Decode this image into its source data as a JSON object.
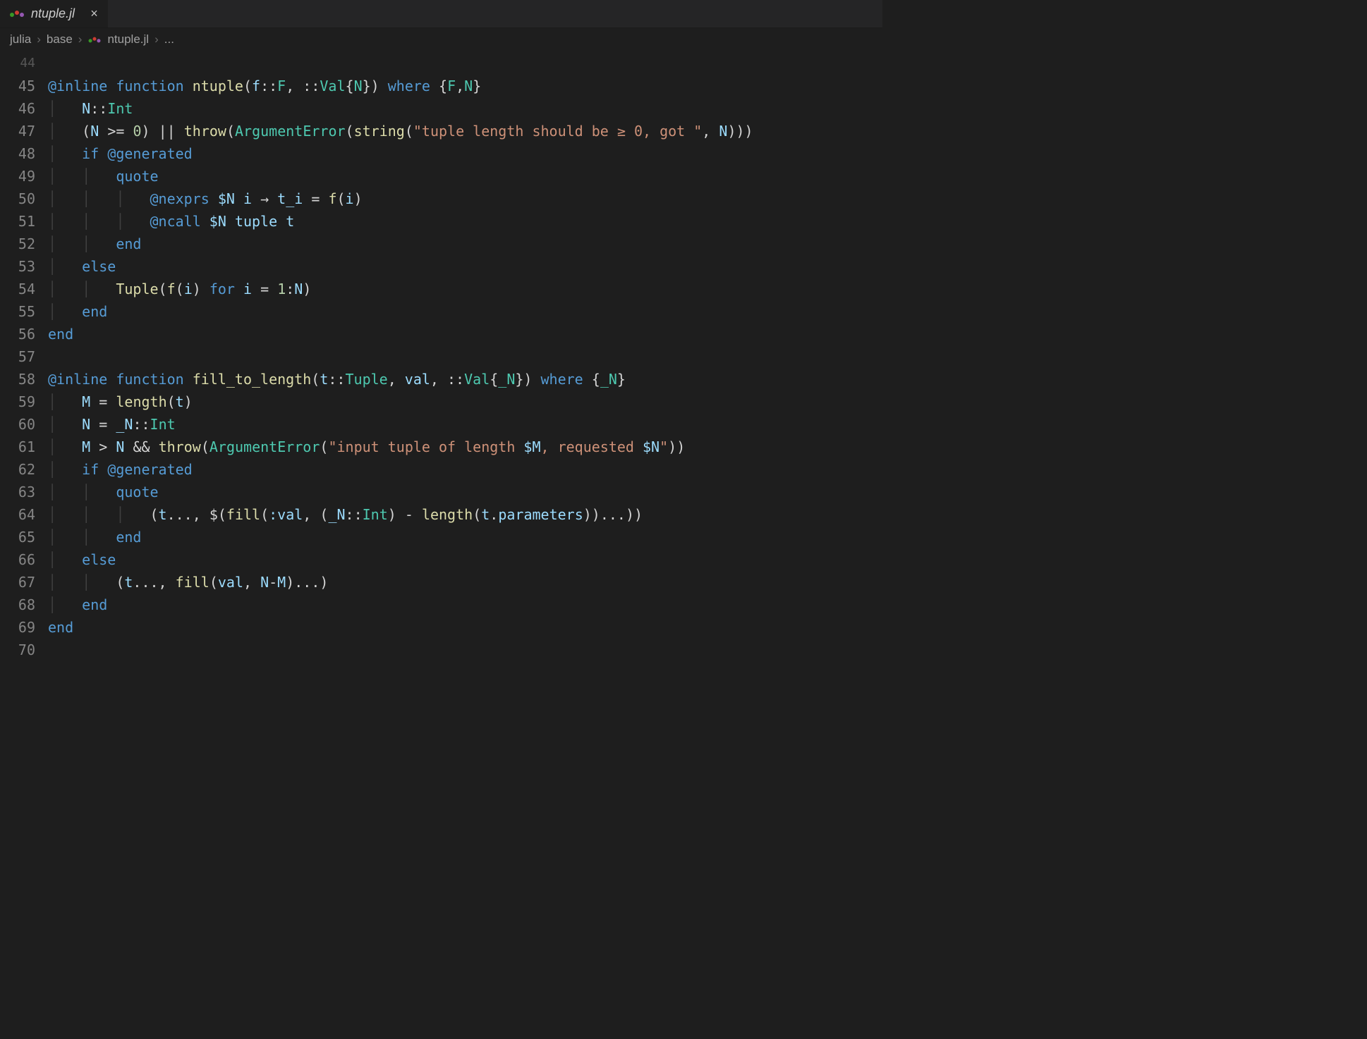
{
  "tab": {
    "filename": "ntuple.jl",
    "close_glyph": "×"
  },
  "breadcrumb": {
    "seg1": "julia",
    "seg2": "base",
    "seg3": "ntuple.jl",
    "ellipsis": "..."
  },
  "gutter": {
    "l44": "44",
    "l45": "45",
    "l46": "46",
    "l47": "47",
    "l48": "48",
    "l49": "49",
    "l50": "50",
    "l51": "51",
    "l52": "52",
    "l53": "53",
    "l54": "54",
    "l55": "55",
    "l56": "56",
    "l57": "57",
    "l58": "58",
    "l59": "59",
    "l60": "60",
    "l61": "61",
    "l62": "62",
    "l63": "63",
    "l64": "64",
    "l65": "65",
    "l66": "66",
    "l67": "67",
    "l68": "68",
    "l69": "69",
    "l70": "70"
  },
  "tokens": {
    "at_inline": "@inline",
    "kw_function": "function",
    "kw_where": "where",
    "kw_if": "if",
    "kw_else": "else",
    "kw_end": "end",
    "kw_for": "for",
    "kw_quote": "quote",
    "at_generated": "@generated",
    "at_nexprs": "@nexprs",
    "at_ncall": "@ncall",
    "fn_ntuple": "ntuple",
    "fn_fill_to_length": "fill_to_length",
    "fn_throw": "throw",
    "fn_string": "string",
    "fn_Tuple": "Tuple",
    "fn_length": "length",
    "fn_fill": "fill",
    "type_F": "F",
    "type_Val": "Val",
    "type_Int": "Int",
    "type_N": "N",
    "type_Tuple": "Tuple",
    "type_ArgumentError": "ArgumentError",
    "type__N": "_N",
    "var_f": "f",
    "var_N": "N",
    "var_M": "M",
    "var_i": "i",
    "var_t": "t",
    "var_t_i": "t_i",
    "var_val": "val",
    "var_tuple": "tuple",
    "var_parameters": "parameters",
    "var_dollarN": "$N",
    "var_dollarM": "$M",
    "var_dollar_N_str": "$N",
    "sym_val": ":val",
    "num_0": "0",
    "num_1": "1",
    "str_tuple_len": "\"tuple length should be ≥ 0, got \"",
    "str_input_tuple_a": "\"input tuple of length ",
    "str_requested": ", requested ",
    "str_close": "\"",
    "punc_open_paren": "(",
    "punc_close_paren": ")",
    "punc_open_brace": "{",
    "punc_close_brace": "}",
    "punc_comma_sp": ", ",
    "punc_dcolon": "::",
    "punc_sp": " ",
    "op_ge": ">=",
    "op_or": "||",
    "op_and": "&&",
    "op_gt": ">",
    "op_eq": "=",
    "op_arrow": "→",
    "op_minus": "-",
    "op_colon": ":",
    "op_splat": "...",
    "op_dollar_open": "$("
  }
}
